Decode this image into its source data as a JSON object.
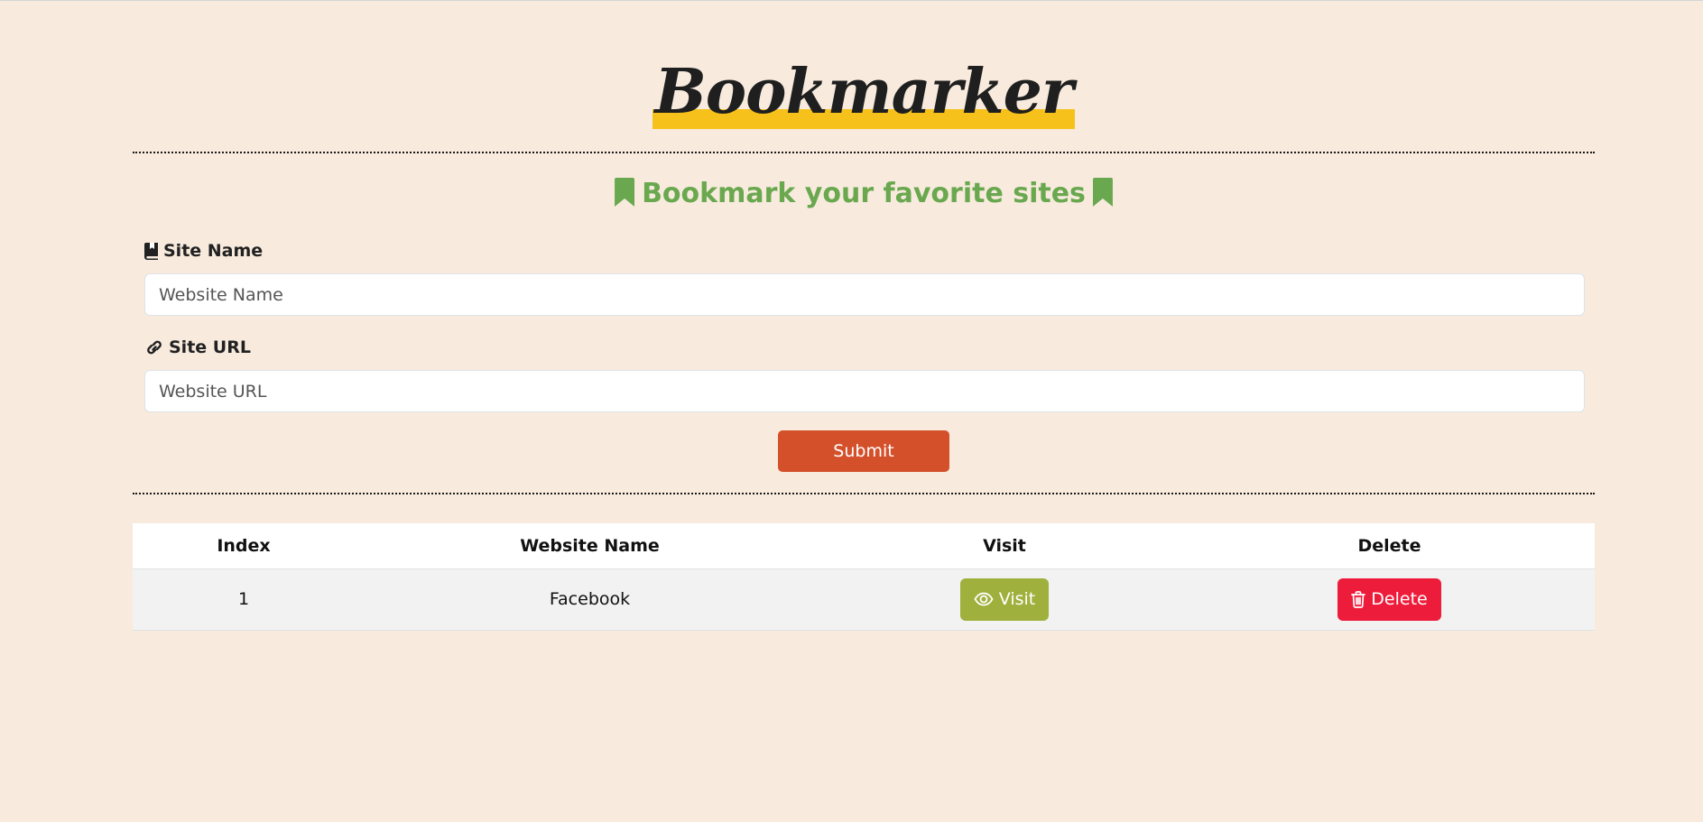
{
  "app": {
    "logo_text": "Bookmarker",
    "subtitle": "Bookmark your favorite sites",
    "accent_color": "#6aa84f",
    "highlight_color": "#f7c11b",
    "background_color": "#f8ebde"
  },
  "form": {
    "site_name_label": "Site Name",
    "site_name_placeholder": "Website Name",
    "site_url_label": "Site URL",
    "site_url_placeholder": "Website URL",
    "submit_label": "Submit",
    "submit_color": "#d4502b"
  },
  "table": {
    "headers": [
      "Index",
      "Website Name",
      "Visit",
      "Delete"
    ],
    "rows": [
      {
        "index": "1",
        "name": "Facebook",
        "visit_label": "Visit",
        "delete_label": "Delete"
      }
    ],
    "visit_color": "#9fb13c",
    "delete_color": "#ee1c3b"
  },
  "icons": {
    "subtitle_left": "bookmark-icon",
    "subtitle_right": "bookmark-icon",
    "site_name": "book-bookmark-icon",
    "site_url": "link-icon",
    "visit": "eye-icon",
    "delete": "trash-icon"
  }
}
